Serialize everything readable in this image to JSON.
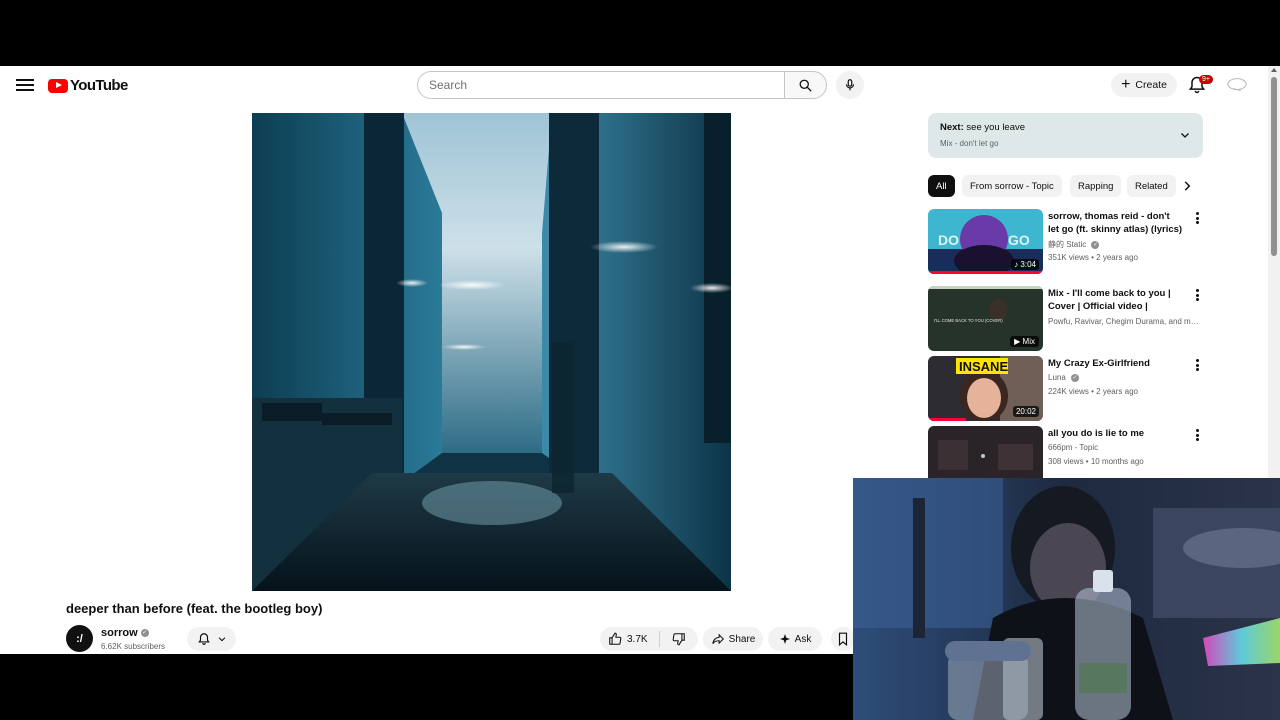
{
  "header": {
    "logo_text": "YouTube",
    "search_placeholder": "Search",
    "create_label": "Create",
    "notification_count": "9+"
  },
  "video": {
    "title": "deeper than before (feat. the bootleg boy)",
    "channel": {
      "avatar_text": ":/",
      "name": "sorrow",
      "subscribers": "6.62K subscribers"
    },
    "actions": {
      "likes": "3.7K",
      "share_label": "Share",
      "ask_label": "Ask"
    }
  },
  "sidebar": {
    "next": {
      "prefix": "Next:",
      "title": "see you leave",
      "subtitle": "Mix - don't let go"
    },
    "chips": [
      "All",
      "From sorrow - Topic",
      "Rapping",
      "Related"
    ],
    "recommendations": [
      {
        "title": "sorrow, thomas reid - don't let go (ft. skinny atlas) (lyrics)",
        "channel": "静的 Static",
        "verified": true,
        "meta": "351K views • 2 years ago",
        "duration": "3:04",
        "watched_fraction": 1.0
      },
      {
        "title": "Mix - I'll come back to you | Cover | Official video |",
        "channel": "Powfu, Ravivar, Chegim Durama, and more",
        "verified": false,
        "meta": "",
        "duration": "Mix",
        "thumb_caption": "I'LL COME BACK TO YOU (COVER)",
        "watched_fraction": 0
      },
      {
        "title": "My Crazy Ex-Girlfriend",
        "channel": "Luna",
        "verified": true,
        "meta": "224K views • 2 years ago",
        "duration": "20:02",
        "thumb_caption": "INSANE",
        "watched_fraction": 0.33
      },
      {
        "title": "all you do is lie to me",
        "channel": "666pm - Topic",
        "verified": false,
        "meta": "308 views • 10 months ago",
        "duration": "",
        "watched_fraction": 0
      }
    ]
  },
  "colors": {
    "brand_red": "#ff0000",
    "progress_red": "#ff0033",
    "next_panel_bg": "#dfe8e9",
    "chip_active_bg": "#0f0f0f"
  }
}
